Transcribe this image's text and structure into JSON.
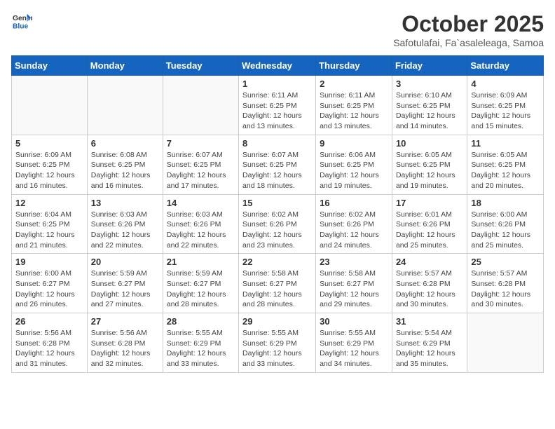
{
  "logo": {
    "general": "General",
    "blue": "Blue"
  },
  "title": "October 2025",
  "subtitle": "Safotulafai, Fa`asaleleaga, Samoa",
  "weekdays": [
    "Sunday",
    "Monday",
    "Tuesday",
    "Wednesday",
    "Thursday",
    "Friday",
    "Saturday"
  ],
  "weeks": [
    [
      {
        "day": "",
        "info": ""
      },
      {
        "day": "",
        "info": ""
      },
      {
        "day": "",
        "info": ""
      },
      {
        "day": "1",
        "info": "Sunrise: 6:11 AM\nSunset: 6:25 PM\nDaylight: 12 hours\nand 13 minutes."
      },
      {
        "day": "2",
        "info": "Sunrise: 6:11 AM\nSunset: 6:25 PM\nDaylight: 12 hours\nand 13 minutes."
      },
      {
        "day": "3",
        "info": "Sunrise: 6:10 AM\nSunset: 6:25 PM\nDaylight: 12 hours\nand 14 minutes."
      },
      {
        "day": "4",
        "info": "Sunrise: 6:09 AM\nSunset: 6:25 PM\nDaylight: 12 hours\nand 15 minutes."
      }
    ],
    [
      {
        "day": "5",
        "info": "Sunrise: 6:09 AM\nSunset: 6:25 PM\nDaylight: 12 hours\nand 16 minutes."
      },
      {
        "day": "6",
        "info": "Sunrise: 6:08 AM\nSunset: 6:25 PM\nDaylight: 12 hours\nand 16 minutes."
      },
      {
        "day": "7",
        "info": "Sunrise: 6:07 AM\nSunset: 6:25 PM\nDaylight: 12 hours\nand 17 minutes."
      },
      {
        "day": "8",
        "info": "Sunrise: 6:07 AM\nSunset: 6:25 PM\nDaylight: 12 hours\nand 18 minutes."
      },
      {
        "day": "9",
        "info": "Sunrise: 6:06 AM\nSunset: 6:25 PM\nDaylight: 12 hours\nand 19 minutes."
      },
      {
        "day": "10",
        "info": "Sunrise: 6:05 AM\nSunset: 6:25 PM\nDaylight: 12 hours\nand 19 minutes."
      },
      {
        "day": "11",
        "info": "Sunrise: 6:05 AM\nSunset: 6:25 PM\nDaylight: 12 hours\nand 20 minutes."
      }
    ],
    [
      {
        "day": "12",
        "info": "Sunrise: 6:04 AM\nSunset: 6:25 PM\nDaylight: 12 hours\nand 21 minutes."
      },
      {
        "day": "13",
        "info": "Sunrise: 6:03 AM\nSunset: 6:26 PM\nDaylight: 12 hours\nand 22 minutes."
      },
      {
        "day": "14",
        "info": "Sunrise: 6:03 AM\nSunset: 6:26 PM\nDaylight: 12 hours\nand 22 minutes."
      },
      {
        "day": "15",
        "info": "Sunrise: 6:02 AM\nSunset: 6:26 PM\nDaylight: 12 hours\nand 23 minutes."
      },
      {
        "day": "16",
        "info": "Sunrise: 6:02 AM\nSunset: 6:26 PM\nDaylight: 12 hours\nand 24 minutes."
      },
      {
        "day": "17",
        "info": "Sunrise: 6:01 AM\nSunset: 6:26 PM\nDaylight: 12 hours\nand 25 minutes."
      },
      {
        "day": "18",
        "info": "Sunrise: 6:00 AM\nSunset: 6:26 PM\nDaylight: 12 hours\nand 25 minutes."
      }
    ],
    [
      {
        "day": "19",
        "info": "Sunrise: 6:00 AM\nSunset: 6:27 PM\nDaylight: 12 hours\nand 26 minutes."
      },
      {
        "day": "20",
        "info": "Sunrise: 5:59 AM\nSunset: 6:27 PM\nDaylight: 12 hours\nand 27 minutes."
      },
      {
        "day": "21",
        "info": "Sunrise: 5:59 AM\nSunset: 6:27 PM\nDaylight: 12 hours\nand 28 minutes."
      },
      {
        "day": "22",
        "info": "Sunrise: 5:58 AM\nSunset: 6:27 PM\nDaylight: 12 hours\nand 28 minutes."
      },
      {
        "day": "23",
        "info": "Sunrise: 5:58 AM\nSunset: 6:27 PM\nDaylight: 12 hours\nand 29 minutes."
      },
      {
        "day": "24",
        "info": "Sunrise: 5:57 AM\nSunset: 6:28 PM\nDaylight: 12 hours\nand 30 minutes."
      },
      {
        "day": "25",
        "info": "Sunrise: 5:57 AM\nSunset: 6:28 PM\nDaylight: 12 hours\nand 30 minutes."
      }
    ],
    [
      {
        "day": "26",
        "info": "Sunrise: 5:56 AM\nSunset: 6:28 PM\nDaylight: 12 hours\nand 31 minutes."
      },
      {
        "day": "27",
        "info": "Sunrise: 5:56 AM\nSunset: 6:28 PM\nDaylight: 12 hours\nand 32 minutes."
      },
      {
        "day": "28",
        "info": "Sunrise: 5:55 AM\nSunset: 6:29 PM\nDaylight: 12 hours\nand 33 minutes."
      },
      {
        "day": "29",
        "info": "Sunrise: 5:55 AM\nSunset: 6:29 PM\nDaylight: 12 hours\nand 33 minutes."
      },
      {
        "day": "30",
        "info": "Sunrise: 5:55 AM\nSunset: 6:29 PM\nDaylight: 12 hours\nand 34 minutes."
      },
      {
        "day": "31",
        "info": "Sunrise: 5:54 AM\nSunset: 6:29 PM\nDaylight: 12 hours\nand 35 minutes."
      },
      {
        "day": "",
        "info": ""
      }
    ]
  ]
}
